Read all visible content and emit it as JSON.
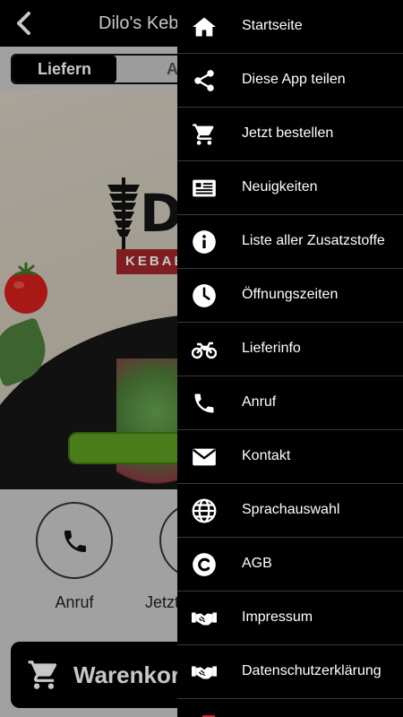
{
  "header": {
    "title": "Dilo's Kebab"
  },
  "segments": [
    "Liefern",
    "Abholen"
  ],
  "hero": {
    "brand_text": "DI",
    "banner_text": "KEBAB & "
  },
  "actions": [
    {
      "label": "Anruf",
      "icon": "phone-icon"
    },
    {
      "label": "Jetzt bestellen",
      "icon": "cart-icon"
    }
  ],
  "cart": {
    "label": "Warenkorb"
  },
  "menu": [
    {
      "label": "Startseite",
      "icon": "home-icon"
    },
    {
      "label": "Diese App teilen",
      "icon": "share-icon"
    },
    {
      "label": "Jetzt bestellen",
      "icon": "cart-icon"
    },
    {
      "label": "Neuigkeiten",
      "icon": "news-icon"
    },
    {
      "label": "Liste aller Zusatzstoffe",
      "icon": "info-icon"
    },
    {
      "label": "Öffnungszeiten",
      "icon": "clock-icon"
    },
    {
      "label": "Lieferinfo",
      "icon": "motorbike-icon"
    },
    {
      "label": "Anruf",
      "icon": "phone-icon"
    },
    {
      "label": "Kontakt",
      "icon": "mail-icon"
    },
    {
      "label": "Sprachauswahl",
      "icon": "globe-icon"
    },
    {
      "label": "AGB",
      "icon": "copyright-icon"
    },
    {
      "label": "Impressum",
      "icon": "handshake-icon"
    },
    {
      "label": "Datenschutzerklärung",
      "icon": "handshake-icon"
    }
  ],
  "colors": {
    "accent_green": "#5fa022",
    "banner_red": "#a5262b",
    "drawer_bg": "#000000"
  }
}
